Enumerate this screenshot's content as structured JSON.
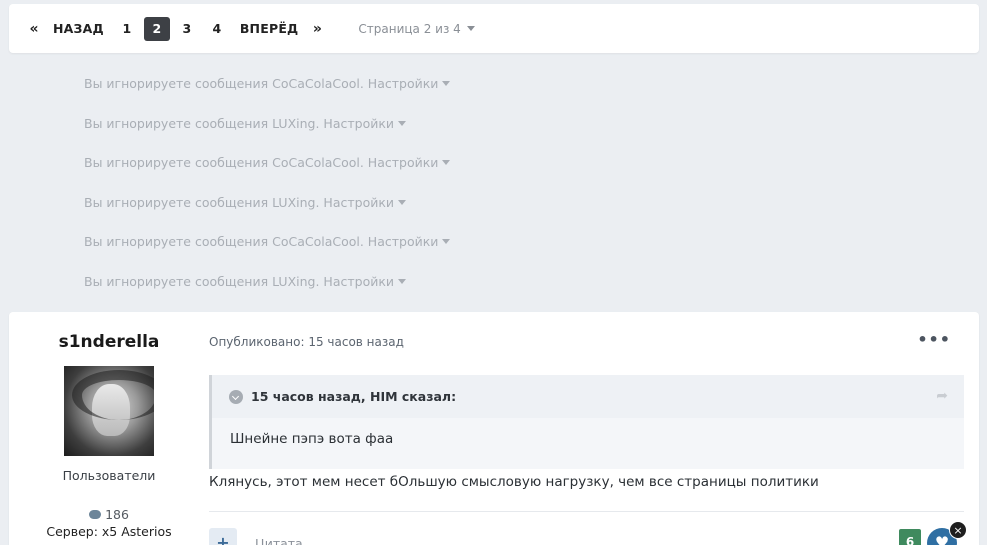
{
  "pagination": {
    "first": "«",
    "prev": "НАЗАД",
    "pages": [
      "1",
      "2",
      "3",
      "4"
    ],
    "next": "ВПЕРЁД",
    "last": "»",
    "info": "Страница 2 из 4"
  },
  "ignored": [
    "Вы игнорируете сообщения CoCaColaCool. Настройки",
    "Вы игнорируете сообщения LUXing. Настройки",
    "Вы игнорируете сообщения CoCaColaCool. Настройки",
    "Вы игнорируете сообщения LUXing. Настройки",
    "Вы игнорируете сообщения CoCaColaCool. Настройки",
    "Вы игнорируете сообщения LUXing. Настройки"
  ],
  "post": {
    "author": "s1nderella",
    "group": "Пользователи",
    "posts_count": "186",
    "server": "Сервер: x5 Asterios",
    "published": "Опубликовано: 15 часов назад",
    "menu": "•••",
    "quote_header": "15 часов назад, HIM сказал:",
    "quote_text": "Шнейне пэпэ вота фаа",
    "text": "Клянусь, этот мем несет бОльшую смысловую нагрузку, чем все страницы политики",
    "add": "+",
    "quote_link": "Цитата",
    "reputation": "6",
    "heart": "♥",
    "close": "×"
  }
}
